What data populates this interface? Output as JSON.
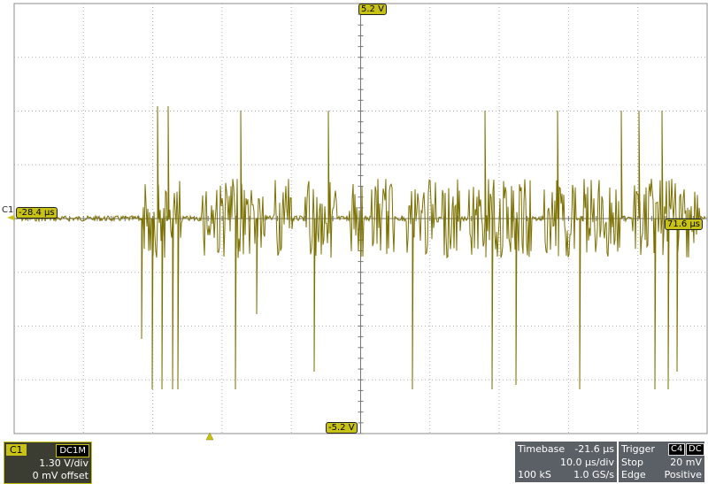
{
  "colors": {
    "trace": "#7b7000",
    "marker": "#c8c214",
    "grid": "#9a9a9a",
    "panel": "#5b6067"
  },
  "markers": {
    "top_level": "5.2 V",
    "bottom_level": "-5.2 V",
    "left_time": "-28.4 µs",
    "right_time": "71.6 µs"
  },
  "channel_id": "C1",
  "channel_panel": {
    "name": "C1",
    "coupling": "DC1M",
    "scale": "1.30 V/div",
    "offset": "0 mV offset"
  },
  "timebase_panel": {
    "title": "Timebase",
    "delay": "-21.6 µs",
    "scale": "10.0 µs/div",
    "samples": "100 kS",
    "rate": "1.0 GS/s"
  },
  "trigger_panel": {
    "title": "Trigger",
    "source": "C4",
    "coupling": "DC",
    "mode": "Stop",
    "level": "20 mV",
    "type": "Edge",
    "slope": "Positive"
  },
  "trigger_position_icon": "triangle-up-icon"
}
